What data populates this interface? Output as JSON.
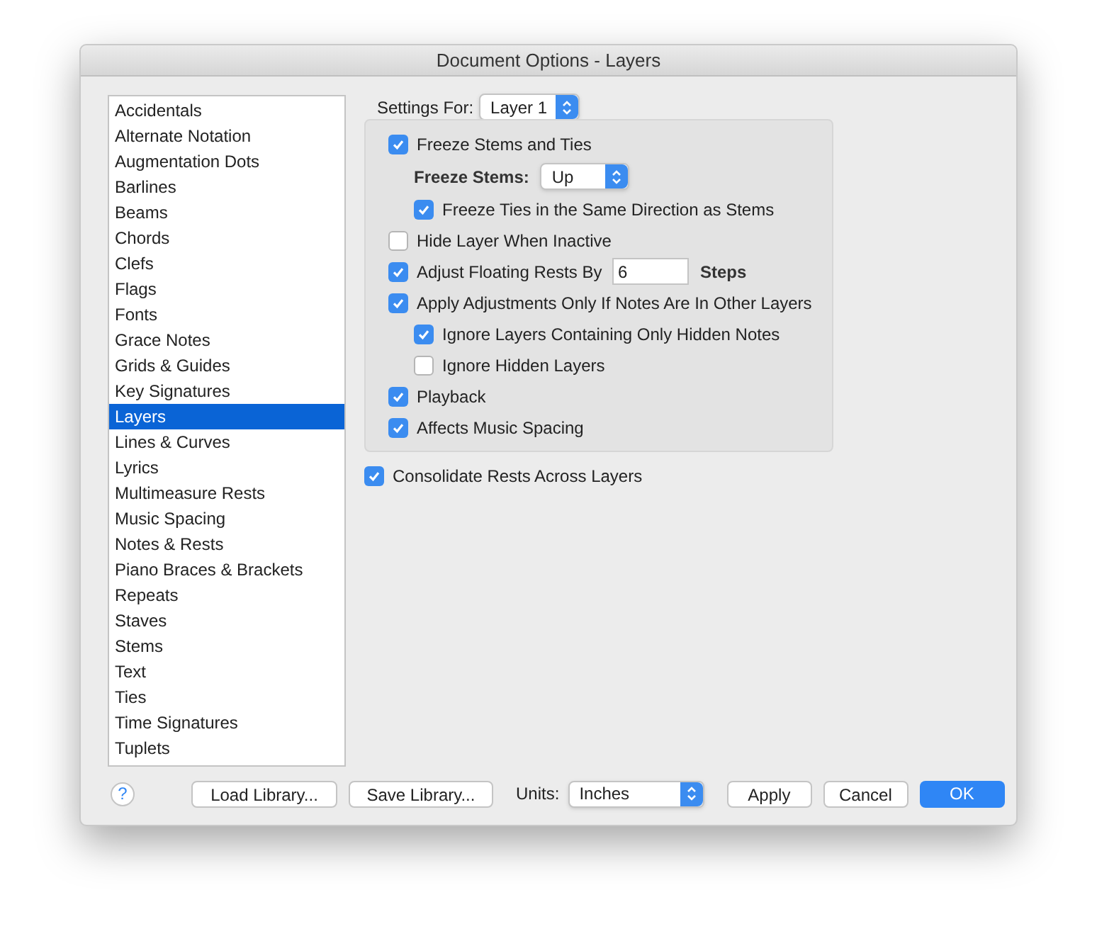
{
  "window": {
    "title": "Document Options - Layers"
  },
  "sidebar": {
    "items": [
      {
        "label": "Accidentals",
        "selected": false
      },
      {
        "label": "Alternate Notation",
        "selected": false
      },
      {
        "label": "Augmentation Dots",
        "selected": false
      },
      {
        "label": "Barlines",
        "selected": false
      },
      {
        "label": "Beams",
        "selected": false
      },
      {
        "label": "Chords",
        "selected": false
      },
      {
        "label": "Clefs",
        "selected": false
      },
      {
        "label": "Flags",
        "selected": false
      },
      {
        "label": "Fonts",
        "selected": false
      },
      {
        "label": "Grace Notes",
        "selected": false
      },
      {
        "label": "Grids & Guides",
        "selected": false
      },
      {
        "label": "Key Signatures",
        "selected": false
      },
      {
        "label": "Layers",
        "selected": true
      },
      {
        "label": "Lines & Curves",
        "selected": false
      },
      {
        "label": "Lyrics",
        "selected": false
      },
      {
        "label": "Multimeasure Rests",
        "selected": false
      },
      {
        "label": "Music Spacing",
        "selected": false
      },
      {
        "label": "Notes & Rests",
        "selected": false
      },
      {
        "label": "Piano Braces & Brackets",
        "selected": false
      },
      {
        "label": "Repeats",
        "selected": false
      },
      {
        "label": "Staves",
        "selected": false
      },
      {
        "label": "Stems",
        "selected": false
      },
      {
        "label": "Text",
        "selected": false
      },
      {
        "label": "Ties",
        "selected": false
      },
      {
        "label": "Time Signatures",
        "selected": false
      },
      {
        "label": "Tuplets",
        "selected": false
      }
    ]
  },
  "settings_for": {
    "label": "Settings For:",
    "value": "Layer 1"
  },
  "options": [
    {
      "kind": "checkbox",
      "label": "Freeze Stems and Ties",
      "checked": true,
      "children": [
        {
          "kind": "popup",
          "label": "Freeze Stems:",
          "value": "Up"
        },
        {
          "kind": "checkbox",
          "label": "Freeze Ties in the Same Direction as Stems",
          "checked": true
        }
      ]
    },
    {
      "kind": "checkbox",
      "label": "Hide Layer When Inactive",
      "checked": false
    },
    {
      "kind": "number",
      "label": "Adjust Floating Rests By",
      "checked": true,
      "value": "6",
      "unit": "Steps"
    },
    {
      "kind": "checkbox",
      "label": "Apply Adjustments Only If Notes Are In Other Layers",
      "checked": true,
      "children": [
        {
          "kind": "checkbox",
          "label": "Ignore Layers Containing Only Hidden Notes",
          "checked": true
        },
        {
          "kind": "checkbox",
          "label": "Ignore Hidden Layers",
          "checked": false
        }
      ]
    },
    {
      "kind": "checkbox",
      "label": "Playback",
      "checked": true
    },
    {
      "kind": "checkbox",
      "label": "Affects Music Spacing",
      "checked": true
    }
  ],
  "consolidate": {
    "label": "Consolidate Rests Across Layers",
    "checked": true
  },
  "footer": {
    "help": "?",
    "load": "Load Library...",
    "save": "Save Library...",
    "units_label": "Units:",
    "units_value": "Inches",
    "apply": "Apply",
    "cancel": "Cancel",
    "ok": "OK"
  }
}
